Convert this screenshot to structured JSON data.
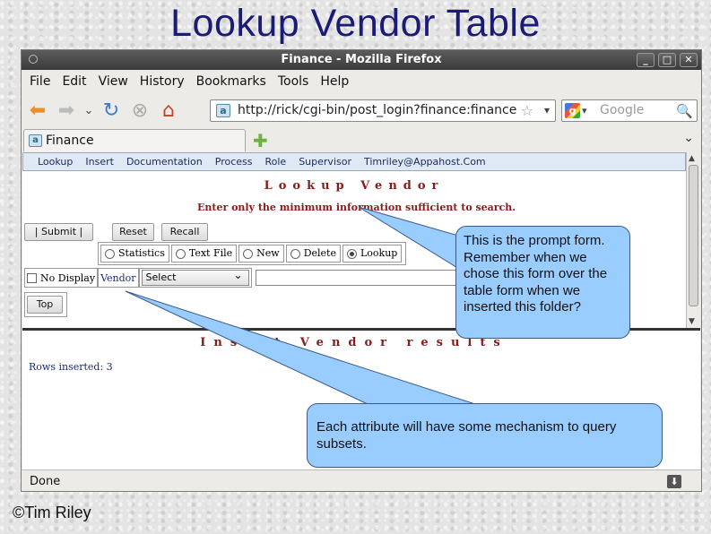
{
  "slide": {
    "title": "Lookup Vendor Table",
    "credit": "©Tim Riley"
  },
  "window": {
    "title": "Finance - Mozilla Firefox",
    "controls": [
      "_",
      "□",
      "✕"
    ],
    "menu": [
      "File",
      "Edit",
      "View",
      "History",
      "Bookmarks",
      "Tools",
      "Help"
    ],
    "url": "http://rick/cgi-bin/post_login?finance:finance",
    "search_placeholder": "Google",
    "tab_label": "Finance",
    "status": "Done"
  },
  "app": {
    "menu": [
      "Lookup",
      "Insert",
      "Documentation",
      "Process",
      "Role",
      "Supervisor",
      "Timriley@Appahost.Com"
    ],
    "heading": "Lookup Vendor",
    "instruction": "Enter only the minimum information sufficient to search.",
    "buttons": {
      "submit": "|   Submit   |",
      "reset": "Reset",
      "recall": "Recall",
      "top": "Top"
    },
    "modes": [
      {
        "label": "Statistics",
        "selected": false
      },
      {
        "label": "Text File",
        "selected": false
      },
      {
        "label": "New",
        "selected": false
      },
      {
        "label": "Delete",
        "selected": false
      },
      {
        "label": "Lookup",
        "selected": true
      }
    ],
    "no_display_label": "No Display",
    "field_label": "Vendor",
    "select_value": "Select",
    "text_value": "",
    "results_heading": "Insert Vendor results",
    "rows_inserted": "Rows inserted: 3"
  },
  "callouts": {
    "prompt": "This is the prompt form. Remember when we chose this form over the table form when we inserted this folder?",
    "attribute": "Each attribute will have some mechanism to query subsets."
  }
}
